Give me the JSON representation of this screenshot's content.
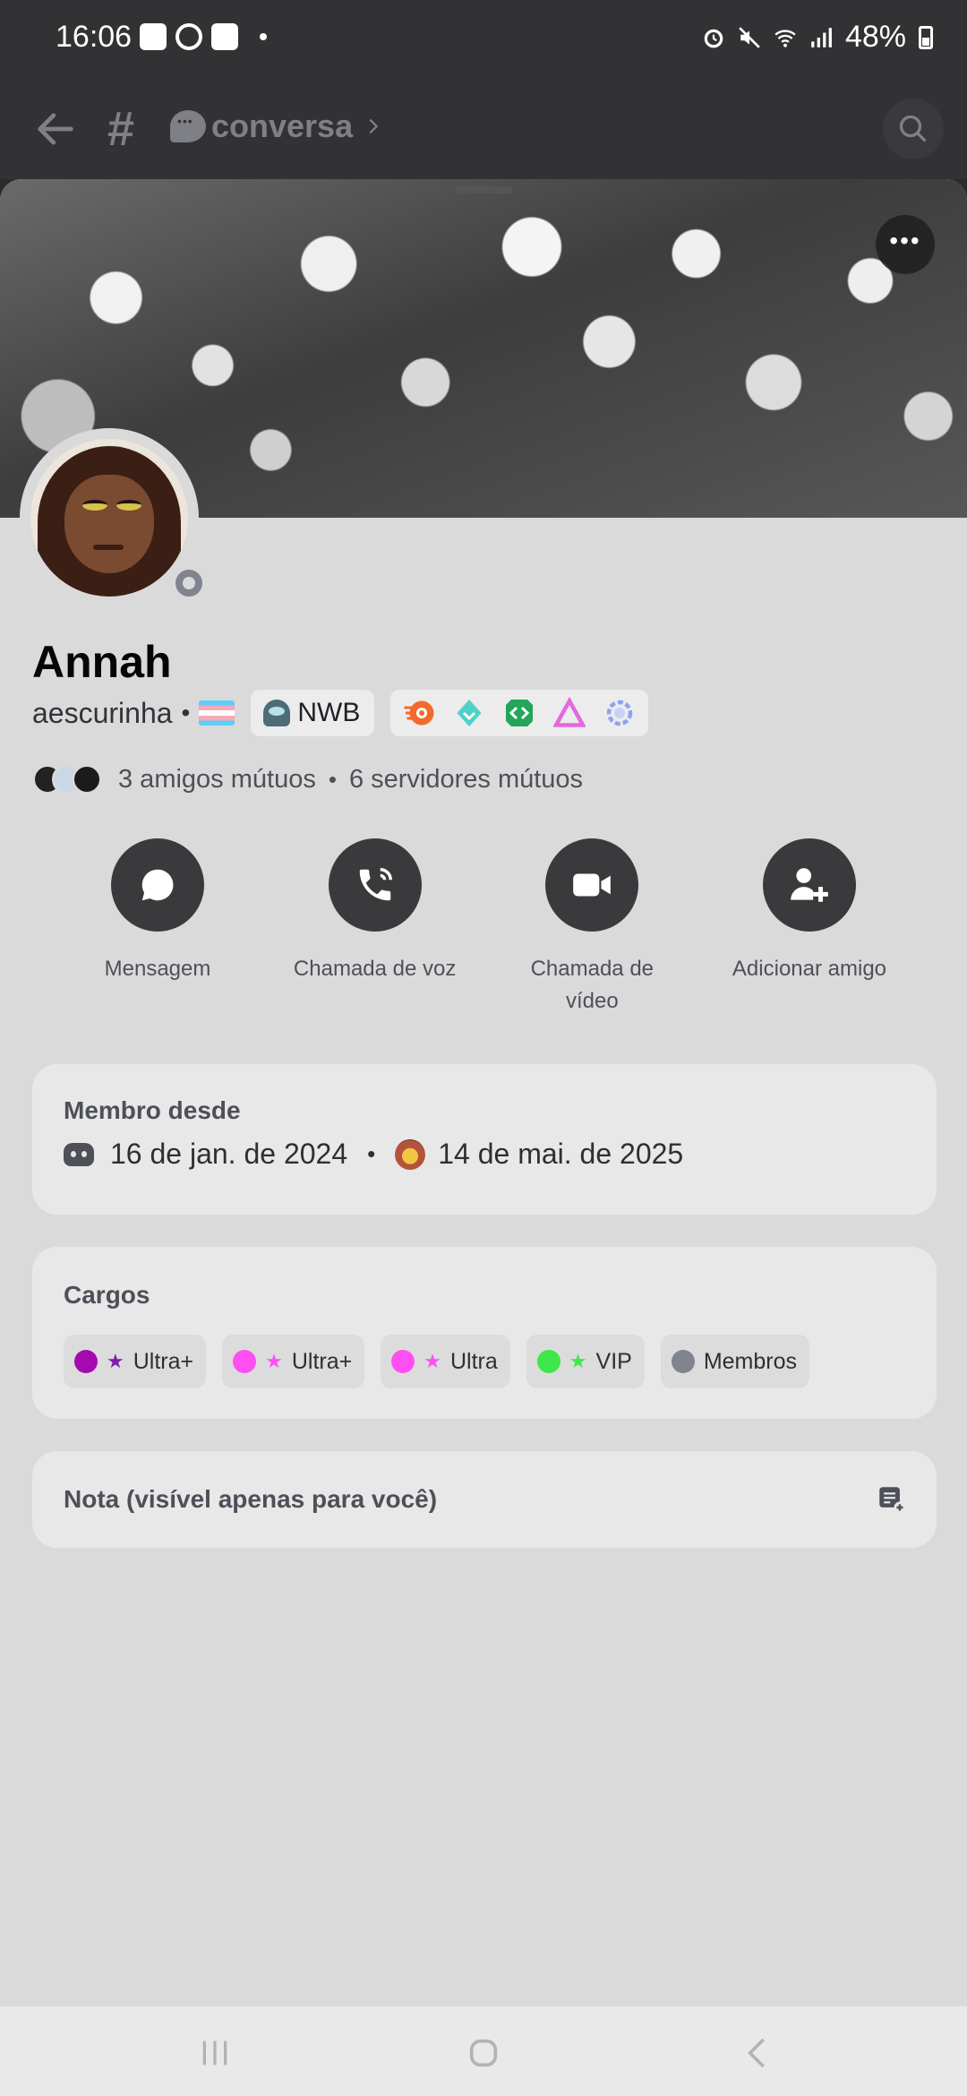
{
  "status_bar": {
    "time": "16:06",
    "battery": "48%",
    "notification_icons": [
      "gallery-icon",
      "whatsapp-icon",
      "shopping-bag-icon"
    ],
    "system_icons": [
      "alarm-icon",
      "mute-icon",
      "wifi-icon",
      "signal-icon",
      "battery-icon"
    ]
  },
  "header": {
    "channel_name": "conversa"
  },
  "profile": {
    "display_name": "Annah",
    "username": "aescurinha",
    "tag": "NWB",
    "badges": [
      "nitro-icon",
      "boost-icon",
      "active-developer-icon",
      "hypesquad-icon",
      "quest-icon"
    ],
    "mutual_friends": "3 amigos mútuos",
    "mutual_servers": "6 servidores mútuos",
    "status": "offline"
  },
  "actions": [
    {
      "label": "Mensagem",
      "icon": "chat-bubble-icon"
    },
    {
      "label": "Chamada de voz",
      "icon": "phone-icon"
    },
    {
      "label": "Chamada de vídeo",
      "icon": "video-camera-icon"
    },
    {
      "label": "Adicionar amigo",
      "icon": "add-friend-icon"
    }
  ],
  "member_since": {
    "title": "Membro desde",
    "discord_date": "16 de jan. de 2024",
    "server_date": "14 de mai. de 2025"
  },
  "roles": {
    "title": "Cargos",
    "items": [
      {
        "label": "Ultra+",
        "color": "#a50ab1",
        "star_color": "#7a1fb0"
      },
      {
        "label": "Ultra+",
        "color": "#ff4ff2",
        "star_color": "#ff4ff2"
      },
      {
        "label": "Ultra",
        "color": "#ff4ff2",
        "star_color": "#ff4ff2"
      },
      {
        "label": "VIP",
        "color": "#3ee84a",
        "star_color": "#3ee84a"
      },
      {
        "label": "Membros",
        "color": "#80848e",
        "star_color": ""
      }
    ]
  },
  "note": {
    "label": "Nota (visível apenas para você)"
  },
  "colors": {
    "sheet_bg": "#dadadb",
    "card_bg": "#e8e8e9",
    "header_bg": "#323234",
    "action_bg": "#3a3a3d"
  }
}
